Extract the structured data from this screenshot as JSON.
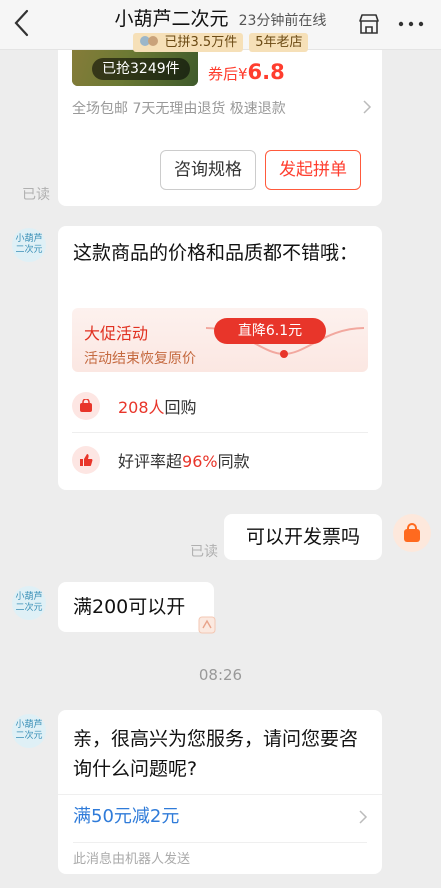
{
  "header": {
    "title": "小葫芦二次元",
    "online": "23分钟前在线",
    "tag_sold": "已拼3.5万件",
    "tag_years": "5年老店"
  },
  "product_card": {
    "sold": "已抢3249件",
    "coupon_prefix": "券后¥",
    "coupon_price": "6.8",
    "services": "全场包邮 7天无理由退货 极速退款",
    "consult_button": "咨询规格",
    "group_button": "发起拼单"
  },
  "read_label": "已读",
  "avatar_label": "小葫芦二次元",
  "promo": {
    "message": "这款商品的价格和品质都不错哦：",
    "banner_title": "大促活动",
    "banner_sub": "活动结束恢复原价",
    "banner_pill": "直降6.1元",
    "repurchase_count": "208人",
    "repurchase_suffix": "回购",
    "rating_prefix": "好评率超",
    "rating_value": "96%",
    "rating_suffix": "同款"
  },
  "outgoing": {
    "text": "可以开发票吗"
  },
  "reply": {
    "text": "满200可以开"
  },
  "time": "08:26",
  "greet": {
    "message": "亲，很高兴为您服务，请问您要咨询什么问题呢?",
    "link": "满50元减2元",
    "note": "此消息由机器人发送"
  },
  "colors": {
    "accent": "#e8352a",
    "link": "#2f7bd9"
  }
}
